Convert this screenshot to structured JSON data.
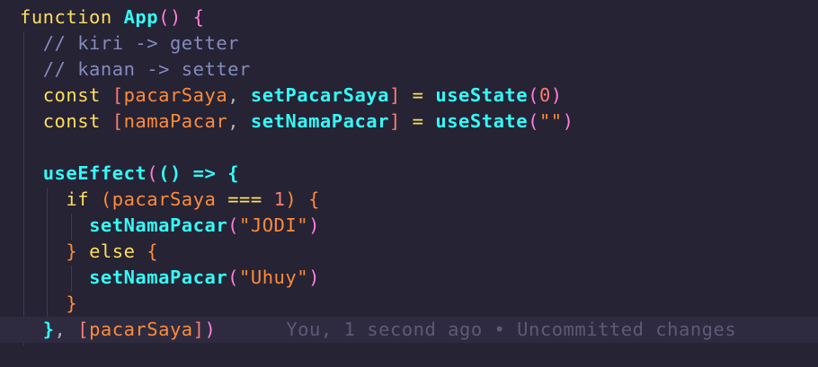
{
  "code": {
    "line1": {
      "kw": "function",
      "name": "App",
      "parens": "()",
      "brace": "{"
    },
    "line2": {
      "comment": "// kiri -> getter"
    },
    "line3": {
      "comment": "// kanan -> setter"
    },
    "line4": {
      "kw": "const",
      "open": "[",
      "var1": "pacarSaya",
      "comma": ",",
      "var2": "setPacarSaya",
      "close": "]",
      "eq": "=",
      "fn": "useState",
      "p_open": "(",
      "arg": "0",
      "p_close": ")"
    },
    "line5": {
      "kw": "const",
      "open": "[",
      "var1": "namaPacar",
      "comma": ",",
      "var2": "setNamaPacar",
      "close": "]",
      "eq": "=",
      "fn": "useState",
      "p_open": "(",
      "arg": "\"\"",
      "p_close": ")"
    },
    "line7": {
      "fn": "useEffect",
      "p_open": "(",
      "arrow_params": "()",
      "arrow": "=>",
      "brace": "{"
    },
    "line8": {
      "kw": "if",
      "p_open": "(",
      "var": "pacarSaya",
      "op": "===",
      "num": "1",
      "p_close": ")",
      "brace": "{"
    },
    "line9": {
      "fn": "setNamaPacar",
      "p_open": "(",
      "str": "\"JODI\"",
      "p_close": ")"
    },
    "line10": {
      "brace_close": "}",
      "kw": "else",
      "brace_open": "{"
    },
    "line11": {
      "fn": "setNamaPacar",
      "p_open": "(",
      "str": "\"Uhuy\"",
      "p_close": ")"
    },
    "line12": {
      "brace": "}"
    },
    "line13": {
      "brace": "}",
      "comma": ",",
      "open": "[",
      "var": "pacarSaya",
      "close": "]",
      "p_close": ")"
    }
  },
  "blame": {
    "text": "You, 1 second ago • Uncommitted changes"
  },
  "colors": {
    "background": "#262335",
    "current_line": "#2e2b40",
    "keyword": "#fede5d",
    "function": "#36f9f6",
    "variable": "#ff8b39",
    "comment": "#848bbd",
    "bracket": "#f97e72",
    "blame": "#5e5a75"
  }
}
